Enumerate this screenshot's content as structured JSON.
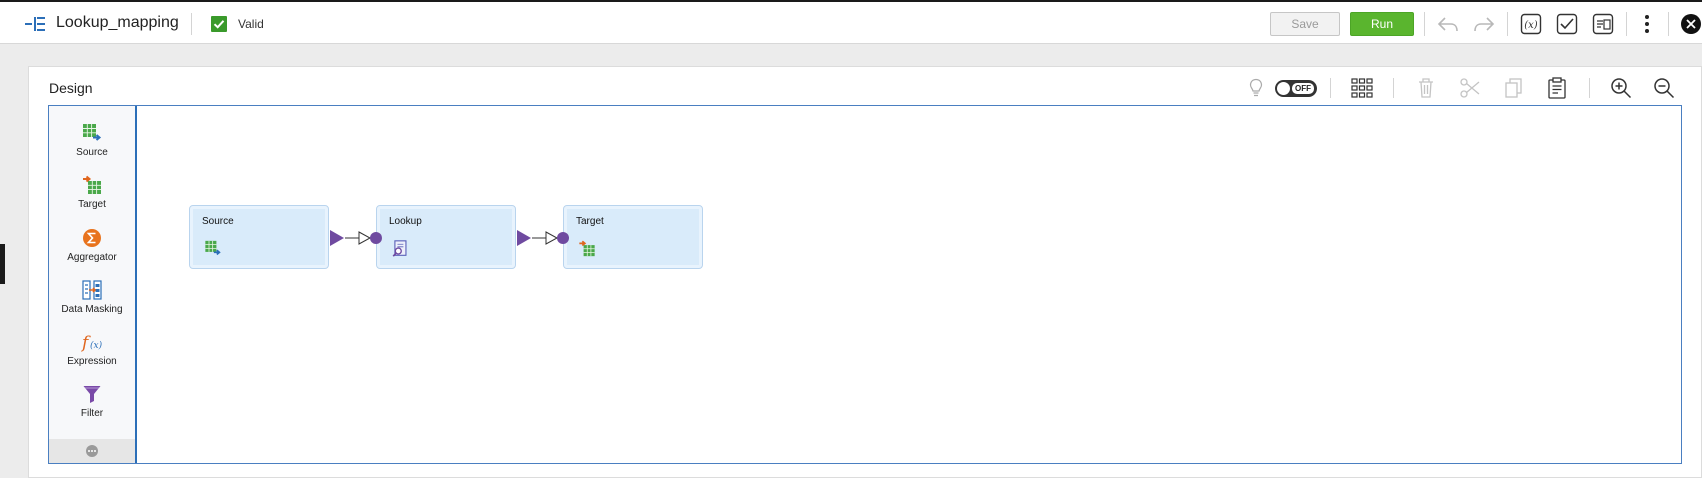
{
  "header": {
    "mapping_name": "Lookup_mapping",
    "status_text": "Valid",
    "save_label": "Save",
    "run_label": "Run"
  },
  "design": {
    "title": "Design",
    "toggle_label": "OFF"
  },
  "palette": {
    "items": [
      {
        "label": "Source",
        "icon": "source-icon"
      },
      {
        "label": "Target",
        "icon": "target-icon"
      },
      {
        "label": "Aggregator",
        "icon": "aggregator-icon"
      },
      {
        "label": "Data Masking",
        "icon": "data-masking-icon"
      },
      {
        "label": "Expression",
        "icon": "expression-icon"
      },
      {
        "label": "Filter",
        "icon": "filter-icon"
      }
    ],
    "more_icon": "ellipsis-icon"
  },
  "nodes": [
    {
      "title": "Source",
      "icon": "source-icon"
    },
    {
      "title": "Lookup",
      "icon": "lookup-icon"
    },
    {
      "title": "Target",
      "icon": "target-icon"
    }
  ],
  "colors": {
    "run_green": "#5ab52e",
    "node_fill": "#d9ebfa",
    "connector_purple": "#6f4aa0",
    "canvas_border": "#4a7fc1"
  }
}
